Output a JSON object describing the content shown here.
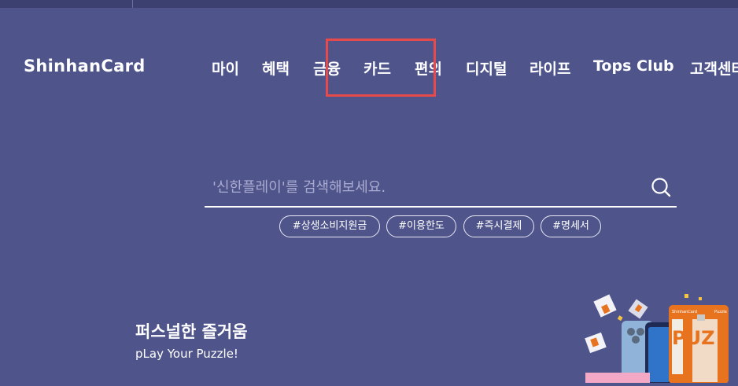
{
  "brand": {
    "logo_text": "ShinhanCard"
  },
  "nav": {
    "items": [
      "마이",
      "혜택",
      "금융",
      "카드",
      "편의",
      "디지털",
      "라이프",
      "Tops Club",
      "고객센터"
    ]
  },
  "search": {
    "placeholder": "'신한플레이'를 검색해보세요.",
    "icon": "search-icon"
  },
  "tags": [
    "#상생소비지원금",
    "#이용한도",
    "#즉시결제",
    "#명세서"
  ],
  "promo": {
    "title": "퍼스널한 즐거움",
    "subtitle": "pLay Your Puzzle!",
    "card_brand": "ShinhanCard",
    "card_name": "Puzzle",
    "card_text": "PUZ"
  },
  "colors": {
    "background": "#4f548b",
    "highlight": "#e64a4a",
    "card_orange": "#e8731f"
  }
}
